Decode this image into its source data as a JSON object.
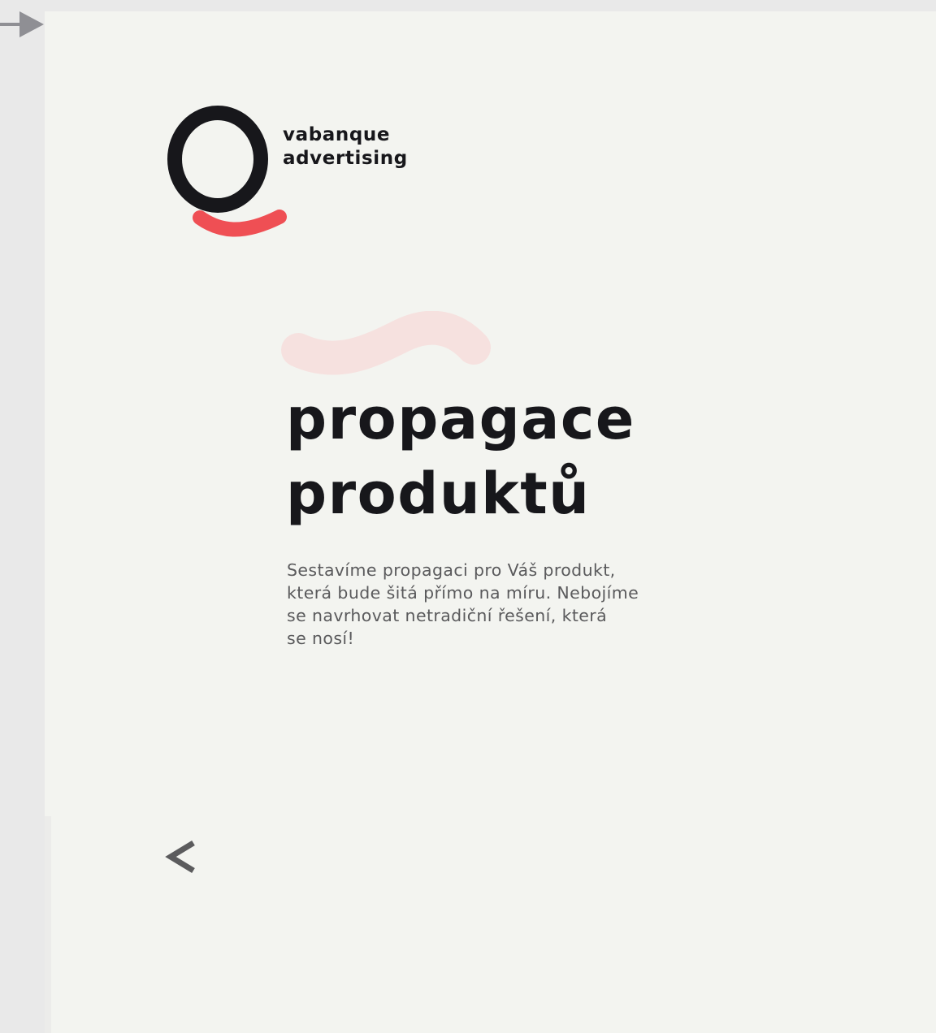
{
  "rail": {
    "expand_icon": "arrow-right-icon",
    "color": "#8f8f94"
  },
  "logo": {
    "icon": "q-logo-icon",
    "line1": "vabanque",
    "line2": "advertising",
    "accent_color": "#ef4f54",
    "ink_color": "#17171b"
  },
  "hero": {
    "decoration_icon": "brush-swoosh-icon",
    "decoration_color": "#f6e1df",
    "title_line1": "propagace",
    "title_line2": "produktů",
    "description_lines": [
      "Sestavíme propagaci pro Váš produkt,",
      "která bude šitá přímo na míru. Nebojíme",
      "se navrhovat netradiční řešení, která",
      "se nosí!"
    ]
  },
  "navigation": {
    "prev_icon": "chevron-left-icon",
    "color": "#5b5b5d"
  },
  "colors": {
    "page_background": "#f3f4f0",
    "rail_background": "#e9e9e9",
    "text_primary": "#17171b",
    "text_secondary": "#5a5a5c"
  }
}
